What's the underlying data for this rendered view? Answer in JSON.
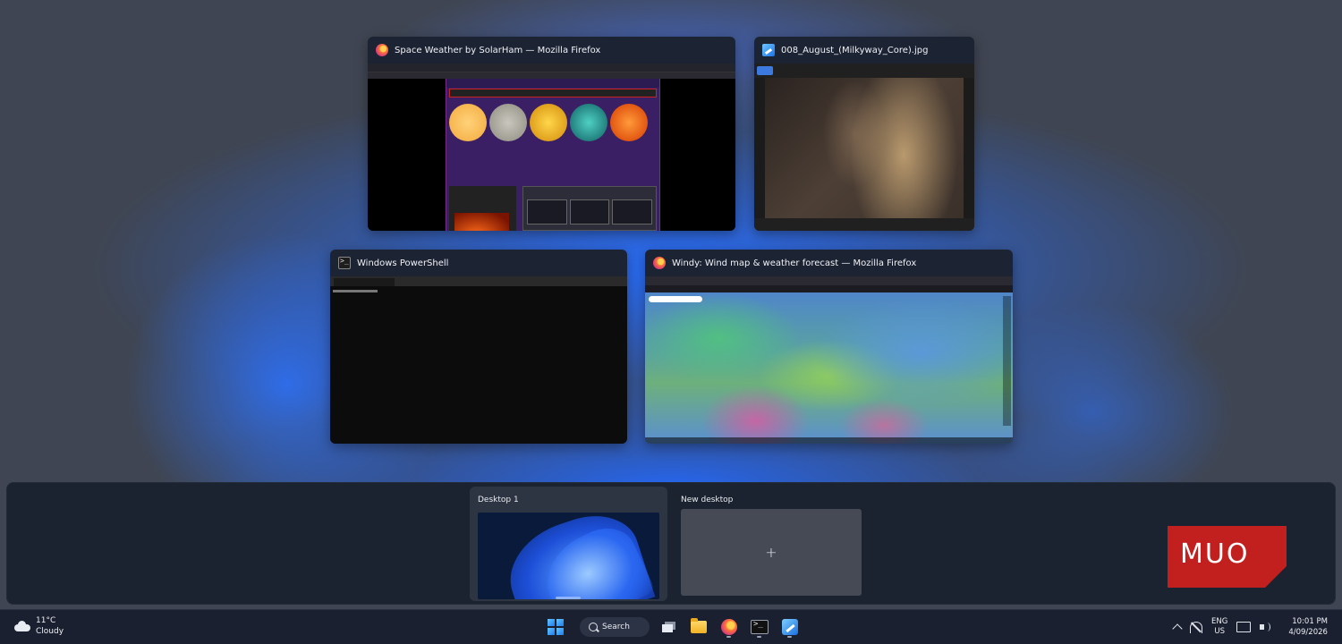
{
  "windows": [
    {
      "title": "Space Weather by SolarHam — Mozilla Firefox",
      "icon": "firefox-icon"
    },
    {
      "title": "008_August_(Milkyway_Core).jpg",
      "icon": "photos-icon"
    },
    {
      "title": "Windows PowerShell",
      "icon": "powershell-icon"
    },
    {
      "title": "Windy: Wind map & weather forecast — Mozilla Firefox",
      "icon": "firefox-icon"
    }
  ],
  "desktops": {
    "current": "Desktop 1",
    "new_label": "New desktop",
    "new_symbol": "+"
  },
  "watermark": "MUO",
  "taskbar": {
    "weather_temp": "11°C",
    "weather_desc": "Cloudy",
    "search_label": "Search",
    "lang_top": "ENG",
    "lang_bottom": "US",
    "time": "10:01 PM",
    "date": "4/09/2026"
  },
  "colors": {
    "accent_blue": "#2f6bff",
    "taskbar_bg": "#1b2030",
    "panel_bg": "#1c2330",
    "watermark_red": "#c21f1f"
  }
}
